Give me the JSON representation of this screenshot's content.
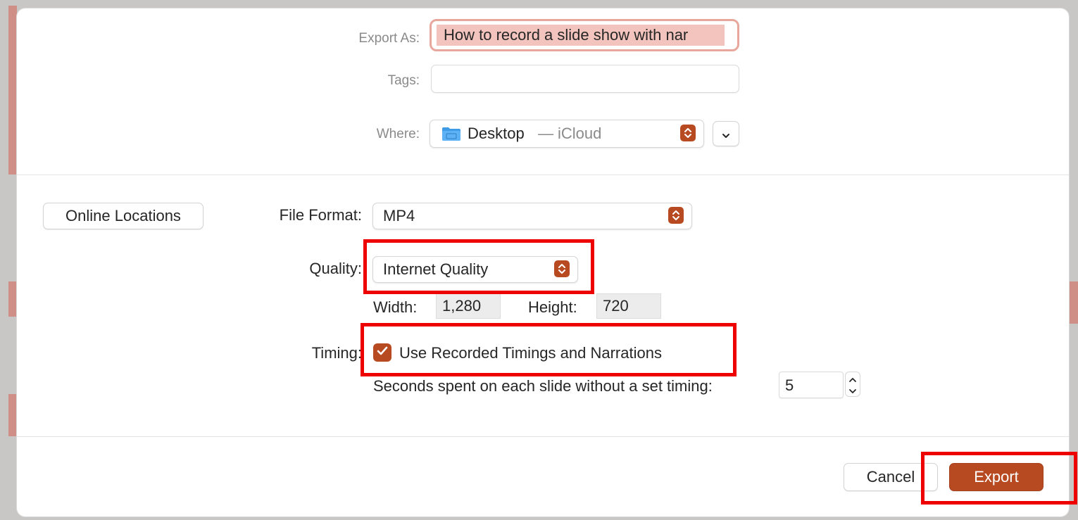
{
  "export_as": {
    "label": "Export As:",
    "value": "How to record a slide show with nar"
  },
  "tags": {
    "label": "Tags:",
    "value": ""
  },
  "where": {
    "label": "Where:",
    "location": "Desktop",
    "separator": " — ",
    "service": "iCloud"
  },
  "online_locations_label": "Online Locations",
  "file_format": {
    "label": "File Format:",
    "value": "MP4"
  },
  "quality": {
    "label": "Quality:",
    "value": "Internet Quality"
  },
  "dimensions": {
    "width_label": "Width:",
    "width_value": "1,280",
    "height_label": "Height:",
    "height_value": "720"
  },
  "timing": {
    "label": "Timing:",
    "checkbox_label": "Use Recorded Timings and Narrations",
    "checked": true
  },
  "seconds": {
    "label": "Seconds spent on each slide without a set timing:",
    "value": "5"
  },
  "buttons": {
    "cancel": "Cancel",
    "export": "Export"
  },
  "colors": {
    "accent": "#b84a22",
    "highlight": "#ee0000",
    "selection": "#f2c4bd"
  }
}
